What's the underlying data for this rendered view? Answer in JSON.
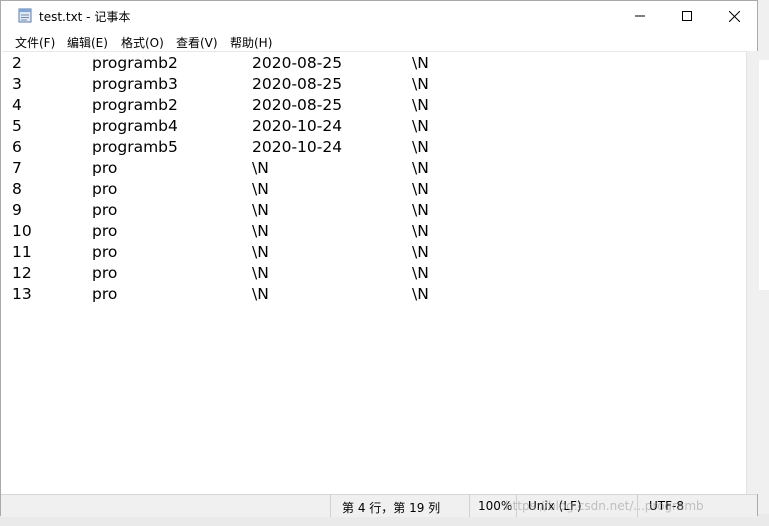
{
  "window": {
    "title": "test.txt - 记事本",
    "icon": "notepad-icon",
    "controls": {
      "minimize": "minimize-icon",
      "maximize": "maximize-icon",
      "close": "close-icon"
    }
  },
  "menu": [
    {
      "label": "文件(F)"
    },
    {
      "label": "编辑(E)"
    },
    {
      "label": "格式(O)"
    },
    {
      "label": "查看(V)"
    },
    {
      "label": "帮助(H)"
    }
  ],
  "editor": {
    "lines": [
      {
        "c1": "2",
        "c2": "programb2",
        "c3": "2020-08-25",
        "c4": "\\N"
      },
      {
        "c1": "3",
        "c2": "programb3",
        "c3": "2020-08-25",
        "c4": "\\N"
      },
      {
        "c1": "4",
        "c2": "programb2",
        "c3": "2020-08-25",
        "c4": "\\N"
      },
      {
        "c1": "5",
        "c2": "programb4",
        "c3": "2020-10-24",
        "c4": "\\N"
      },
      {
        "c1": "6",
        "c2": "programb5",
        "c3": "2020-10-24",
        "c4": "\\N"
      },
      {
        "c1": "7",
        "c2": "pro",
        "c3": "\\N",
        "c4": "\\N"
      },
      {
        "c1": "8",
        "c2": "pro",
        "c3": "\\N",
        "c4": "\\N"
      },
      {
        "c1": "9",
        "c2": "pro",
        "c3": "\\N",
        "c4": "\\N"
      },
      {
        "c1": "10",
        "c2": "pro",
        "c3": "\\N",
        "c4": "\\N"
      },
      {
        "c1": "11",
        "c2": "pro",
        "c3": "\\N",
        "c4": "\\N"
      },
      {
        "c1": "12",
        "c2": "pro",
        "c3": "\\N",
        "c4": "\\N"
      },
      {
        "c1": "13",
        "c2": "pro",
        "c3": "\\N",
        "c4": "\\N"
      }
    ]
  },
  "status": {
    "position": "第 4 行，第 19 列",
    "zoom": "100%",
    "line_ending": "Unix (LF)",
    "encoding": "UTF-8",
    "watermark": "https://blog.csdn.net/...programb"
  }
}
